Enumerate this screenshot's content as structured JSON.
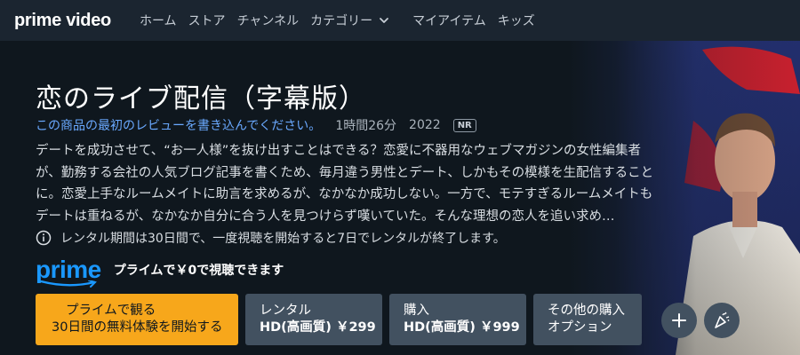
{
  "brand": {
    "logo_text": "prime video"
  },
  "nav": {
    "items": [
      {
        "label": "ホーム"
      },
      {
        "label": "ストア"
      },
      {
        "label": "チャンネル"
      },
      {
        "label": "カテゴリー"
      },
      {
        "label": "マイアイテム"
      },
      {
        "label": "キッズ"
      }
    ]
  },
  "detail": {
    "title": "恋のライブ配信（字幕版）",
    "review_link": "この商品の最初のレビューを書き込んでください。",
    "runtime": "1時間26分",
    "year": "2022",
    "rating": "NR",
    "synopsis": "デートを成功させて、“お一人様”を抜け出すことはできる？恋愛に不器用なウェブマガジンの女性編集者が、勤務する会社の人気ブログ記事を書くため、毎月違う男性とデート、しかもその模様を生配信することに。恋愛上手なルームメイトに助言を求めるが、なかなか成功しない。一方で、モテすぎるルームメイトもデートは重ねるが、なかなか自分に合う人を見つけらず嘆いていた。そんな理想の恋人を追い求め…",
    "rental_notice": "レンタル期間は30日間で、一度視聴を開始すると7日でレンタルが終了します。",
    "prime_logo": "prime",
    "prime_text": "プライムで￥0で視聴できます"
  },
  "actions": {
    "watch_line1": "プライムで観る",
    "watch_line2": "30日間の無料体験を開始する",
    "rent_line1": "レンタル",
    "rent_line2": "HD(高画質) ￥299",
    "buy_line1": "購入",
    "buy_line2": "HD(高画質) ￥999",
    "more_line1": "その他の購入",
    "more_line2": "オプション"
  },
  "icons": {
    "nav_dropdown": "chevron-down-icon",
    "info": "info-icon",
    "watchlist": "plus-icon",
    "watch_party": "party-popper-icon"
  },
  "colors": {
    "background": "#0f171e",
    "nav_background": "#1b2530",
    "accent_orange": "#f7a71b",
    "prime_blue": "#1a98ff",
    "link_blue": "#6aa9ff",
    "button_dark": "#425160"
  }
}
